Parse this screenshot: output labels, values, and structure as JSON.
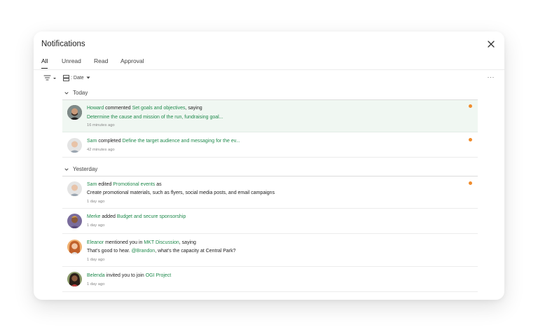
{
  "panel": {
    "title": "Notifications"
  },
  "tabs": [
    {
      "label": "All",
      "active": true
    },
    {
      "label": "Unread",
      "active": false
    },
    {
      "label": "Read",
      "active": false
    },
    {
      "label": "Approval",
      "active": false
    }
  ],
  "toolbar": {
    "sort_label": ": Date",
    "more_label": "···"
  },
  "groups": {
    "today": "Today",
    "yesterday": "Yesterday"
  },
  "colors": {
    "link": "#1f8a4c",
    "unread_dot": "#f08c2c",
    "highlight": "#f0f7f2"
  },
  "items": [
    {
      "user": "Howard",
      "action": " commented ",
      "target": "Set goals and objectives",
      "suffix": ", saying",
      "detail": "Determine the cause and mission of the run, fundraising goal...",
      "time": "16 minutes ago",
      "unread": true
    },
    {
      "user": "Sam",
      "action": " completed ",
      "target": "Define the target audience and messaging for the ev...",
      "suffix": "",
      "time": "42 minutes ago",
      "unread": true
    },
    {
      "user": "Sam",
      "action": " edited ",
      "target": "Promotional events",
      "suffix": " as",
      "detail": "Create promotional materials, such as flyers, social media posts, and email campaigns",
      "time": "1 day ago",
      "unread": true
    },
    {
      "user": "Merke",
      "action": " added ",
      "target": "Budget and secure sponsorship",
      "suffix": "",
      "time": "1 day ago",
      "unread": false
    },
    {
      "user": "Eleanor",
      "action": " mentioned you in ",
      "target": "MKT Discussion",
      "suffix": ", saying",
      "detail_pre": "That's good to hear. ",
      "detail_mention": "@Brandon",
      "detail_post": ", what's the capacity at Central Park?",
      "time": "1 day ago",
      "unread": false
    },
    {
      "user": "Belenda",
      "action": " invited you to join ",
      "target": "OGI Project",
      "suffix": "",
      "time": "1 day ago",
      "unread": false
    }
  ]
}
